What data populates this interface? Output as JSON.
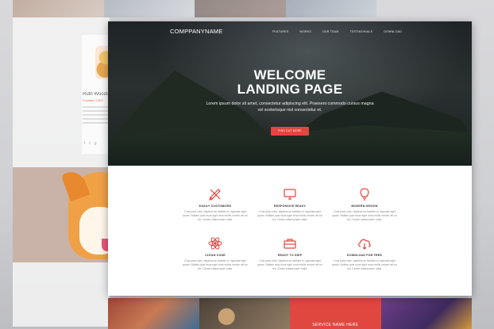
{
  "brand": "COMPPANYNAME",
  "nav": [
    "FEATURES",
    "WORKS",
    "OUR TEAM",
    "TESTIMONIALS",
    "DOWNLOAD"
  ],
  "hero": {
    "title_line1": "WELCOME",
    "title_line2": "LANDING PAGE",
    "subtitle": "Lorem ipsum dolor sit amet, consectetur adipiscing elit. Praesent commodo cursus magna vel scelerisque nisl consectetur et.",
    "button": "FIND OUT MORE"
  },
  "features": [
    {
      "icon": "pencil-ruler-icon",
      "title": "EASILY CUSTOMIZED",
      "text": "Cras justo odio, dapibus ac facilisis in, egestas eget quam. Nullam quis risus eget urna mollis ornare vel eu leo. Donec ullamcorper nulla."
    },
    {
      "icon": "monitor-icon",
      "title": "RESPONSIVE READY",
      "text": "Cras justo odio, dapibus ac facilisis in, egestas eget quam. Nullam quis risus eget urna mollis ornare vel eu leo. Donec ullamcorper nulla."
    },
    {
      "icon": "lightbulb-icon",
      "title": "MODERN DESIGN",
      "text": "Cras justo odio, dapibus ac facilisis in, egestas eget quam. Nullam quis risus eget urna mollis ornare vel eu leo. Donec ullamcorper nulla."
    },
    {
      "icon": "atom-icon",
      "title": "CLEAN CODE",
      "text": "Cras justo odio, dapibus ac facilisis in, egestas eget quam. Nullam quis risus eget urna mollis ornare vel eu leo. Donec ullamcorper nulla."
    },
    {
      "icon": "toolbox-icon",
      "title": "READY TO SHIP",
      "text": "Cras justo odio, dapibus ac facilisis in, egestas eget quam. Nullam quis risus eget urna mollis ornare vel eu leo. Donec ullamcorper nulla."
    },
    {
      "icon": "cloud-download-icon",
      "title": "DOWNLOAD FOR FREE",
      "text": "Cras justo odio, dapibus ac facilisis in, egestas eget quam. Nullam quis risus eget urna mollis ornare vel eu leo. Donec ullamcorper nulla."
    }
  ],
  "background_profile": {
    "name": "Ruth Woods",
    "role": "Founder, CEO",
    "social": [
      "facebook-icon",
      "twitter-icon",
      "google-plus-icon"
    ]
  },
  "portfolio_caption": "SERVICE NAME HERE",
  "colors": {
    "accent": "#e0473f",
    "hero_dark": "#1e2326",
    "text_dark": "#333333",
    "text_muted": "#888888"
  }
}
